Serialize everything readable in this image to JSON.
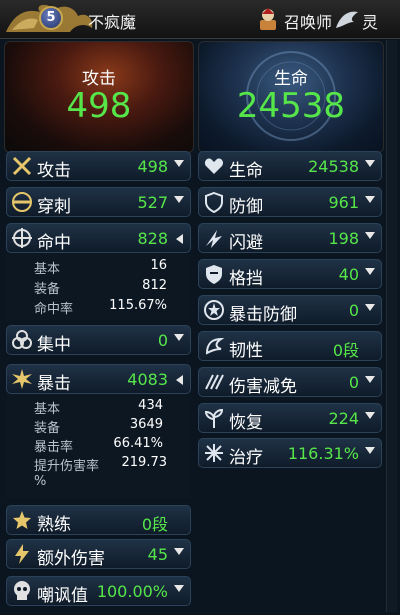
{
  "player": {
    "level": "5",
    "name": "不疯魔"
  },
  "header": {
    "summoner_label": "召唤师",
    "spirit_label": "灵"
  },
  "attack_panel": {
    "title": "攻击",
    "value": "498"
  },
  "life_panel": {
    "title": "生命",
    "value": "24538"
  },
  "left_stats": [
    {
      "label": "攻击",
      "value": "498",
      "arrow": "down",
      "icon": "crossed-swords-icon"
    },
    {
      "label": "穿刺",
      "value": "527",
      "arrow": "down",
      "icon": "pierce-icon"
    },
    {
      "label": "命中",
      "value": "828",
      "arrow": "left",
      "icon": "crosshair-icon"
    },
    {
      "label": "集中",
      "value": "0",
      "arrow": "down",
      "icon": "focus-icon"
    },
    {
      "label": "暴击",
      "value": "4083",
      "arrow": "left",
      "icon": "burst-icon"
    },
    {
      "label": "熟练",
      "value": "0段",
      "arrow": "none",
      "icon": "star-icon"
    },
    {
      "label": "额外伤害",
      "value": "45",
      "arrow": "down",
      "icon": "lightning-icon"
    },
    {
      "label": "嘲讽值",
      "value": "100.00%",
      "arrow": "down",
      "icon": "skull-icon"
    }
  ],
  "hit_details": [
    {
      "label": "基本",
      "value": "16"
    },
    {
      "label": "装备",
      "value": "812"
    },
    {
      "label": "命中率",
      "value": "115.67%"
    }
  ],
  "crit_details": [
    {
      "label": "基本",
      "value": "434"
    },
    {
      "label": "装备",
      "value": "3649"
    },
    {
      "label": "暴击率",
      "value": "66.41%"
    },
    {
      "label": "提升伤害率",
      "value": "219.73"
    }
  ],
  "crit_wrap": "%",
  "right_stats": [
    {
      "label": "生命",
      "value": "24538",
      "arrow": "down",
      "icon": "heart-icon"
    },
    {
      "label": "防御",
      "value": "961",
      "arrow": "down",
      "icon": "shield-icon"
    },
    {
      "label": "闪避",
      "value": "198",
      "arrow": "down",
      "icon": "dodge-icon"
    },
    {
      "label": "格挡",
      "value": "40",
      "arrow": "down",
      "icon": "block-icon"
    },
    {
      "label": "暴击防御",
      "value": "0",
      "arrow": "down",
      "icon": "crit-defense-icon"
    },
    {
      "label": "韧性",
      "value": "0段",
      "arrow": "none",
      "icon": "toughness-icon"
    },
    {
      "label": "伤害减免",
      "value": "0",
      "arrow": "down",
      "icon": "damage-reduction-icon"
    },
    {
      "label": "恢复",
      "value": "224",
      "arrow": "down",
      "icon": "recovery-icon"
    },
    {
      "label": "治疗",
      "value": "116.31%",
      "arrow": "down",
      "icon": "heal-icon"
    }
  ],
  "colors": {
    "value_green": "#56e64a",
    "label_white": "#ffffff",
    "row_bg": "#1f3246"
  }
}
